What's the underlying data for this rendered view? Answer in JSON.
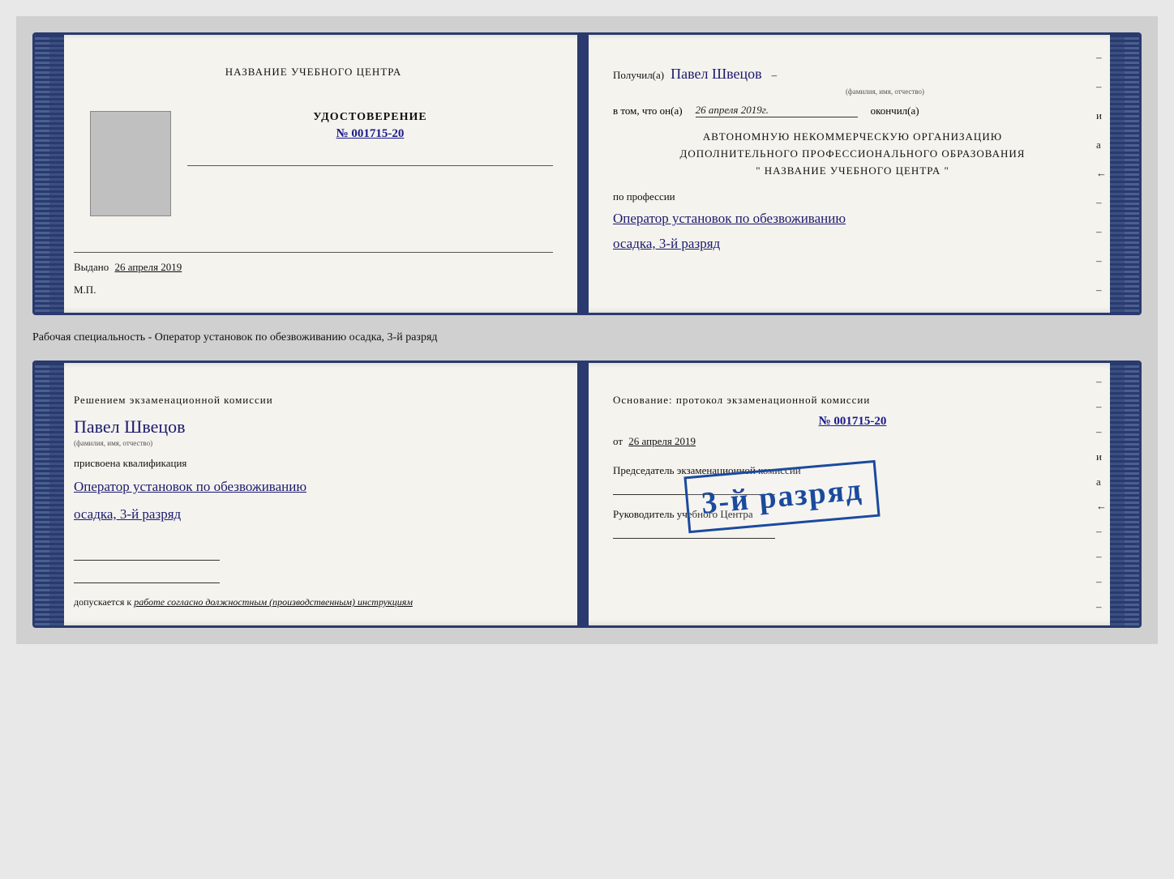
{
  "page": {
    "background": "#d0d0d0"
  },
  "top_document": {
    "left": {
      "center_title": "НАЗВАНИЕ УЧЕБНОГО ЦЕНТРА",
      "cert_label": "УДОСТОВЕРЕНИЕ",
      "cert_number_prefix": "№",
      "cert_number": "001715-20",
      "issued_label": "Выдано",
      "issued_date": "26 апреля 2019",
      "mp_label": "М.П."
    },
    "right": {
      "received_prefix": "Получил(а)",
      "recipient_name": "Павел Швецов",
      "fio_caption": "(фамилия, имя, отчество)",
      "dash": "–",
      "in_that_prefix": "в том, что он(а)",
      "date_italic": "26 апреля 2019г.",
      "completed_suffix": "окончил(а)",
      "org_line1": "АВТОНОМНУЮ НЕКОММЕРЧЕСКУЮ ОРГАНИЗАЦИЮ",
      "org_line2": "ДОПОЛНИТЕЛЬНОГО ПРОФЕССИОНАЛЬНОГО ОБРАЗОВАНИЯ",
      "org_line3": "\"   НАЗВАНИЕ УЧЕБНОГО ЦЕНТРА   \"",
      "profession_label": "по профессии",
      "profession_line1": "Оператор установок по обезвоживанию",
      "profession_line2": "осадка, 3-й разряд",
      "right_margin_chars": [
        "–",
        "–",
        "и",
        "а",
        "←",
        "–",
        "–",
        "–",
        "–"
      ]
    }
  },
  "between_text": "Рабочая специальность - Оператор установок по обезвоживанию осадка, 3-й разряд",
  "bottom_document": {
    "left": {
      "decision_text": "Решением  экзаменационной  комиссии",
      "person_name": "Павел Швецов",
      "fio_caption": "(фамилия, имя, отчество)",
      "assigned_label": "присвоена квалификация",
      "qualification_line1": "Оператор установок по обезвоживанию",
      "qualification_line2": "осадка, 3-й разряд",
      "допуск_prefix": "допускается к",
      "допуск_text": "работе согласно должностным (производственным) инструкциям"
    },
    "right": {
      "osnov_text": "Основание: протокол экзаменационной  комиссии",
      "protocol_prefix": "№",
      "protocol_number": "001715-20",
      "ot_prefix": "от",
      "ot_date": "26 апреля 2019",
      "chairman_label": "Председатель экзаменационной комиссии",
      "rukov_label": "Руководитель учебного Центра",
      "right_margin_chars": [
        "–",
        "–",
        "–",
        "и",
        "а",
        "←",
        "–",
        "–",
        "–",
        "–"
      ]
    },
    "stamp": {
      "text": "3-й разряд"
    }
  }
}
